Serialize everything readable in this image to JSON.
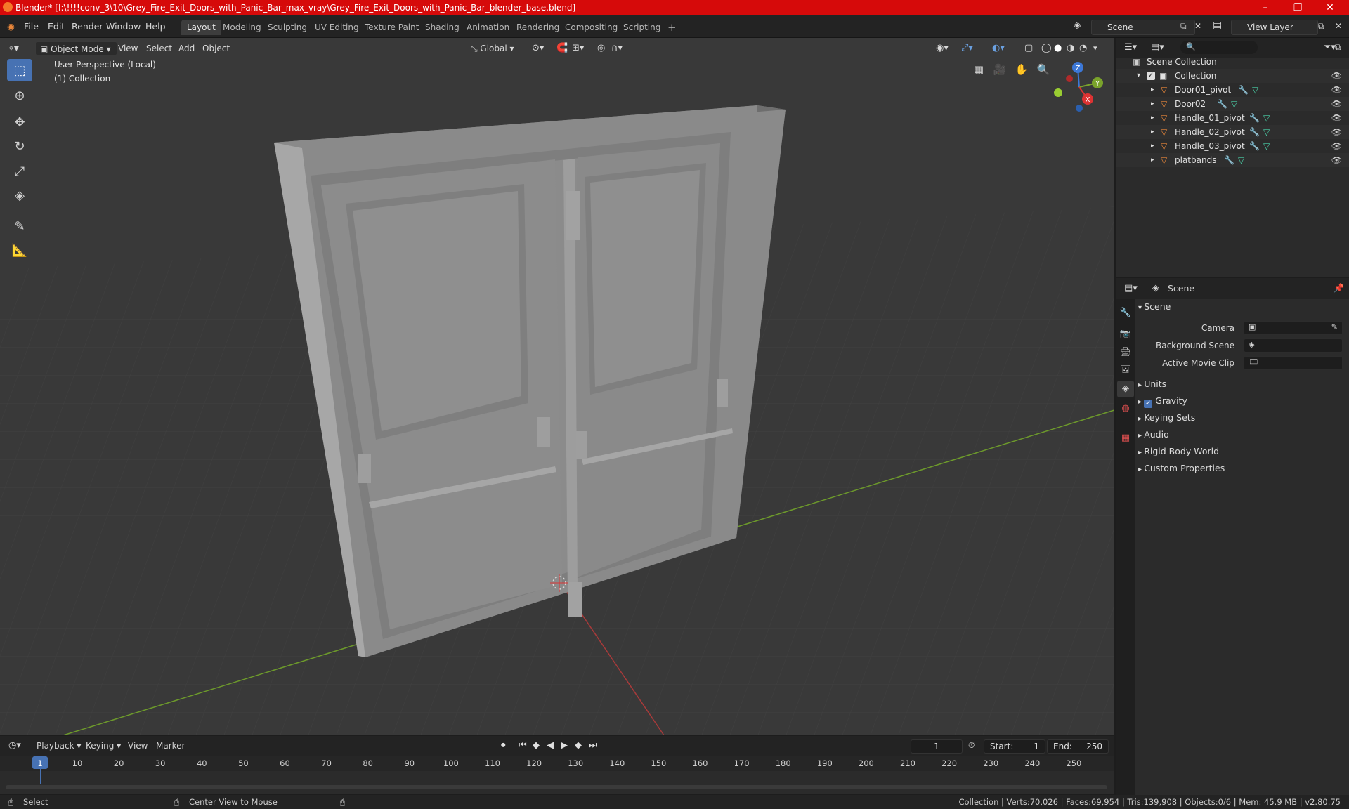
{
  "window": {
    "title": "Blender* [I:\\!!!!conv_3\\10\\Grey_Fire_Exit_Doors_with_Panic_Bar_max_vray\\Grey_Fire_Exit_Doors_with_Panic_Bar_blender_base.blend]"
  },
  "menu": [
    "File",
    "Edit",
    "Render",
    "Window",
    "Help"
  ],
  "workspaces": [
    {
      "label": "Layout",
      "active": true
    },
    {
      "label": "Modeling"
    },
    {
      "label": "Sculpting"
    },
    {
      "label": "UV Editing"
    },
    {
      "label": "Texture Paint"
    },
    {
      "label": "Shading"
    },
    {
      "label": "Animation"
    },
    {
      "label": "Rendering"
    },
    {
      "label": "Compositing"
    },
    {
      "label": "Scripting"
    }
  ],
  "scene_field": "Scene",
  "view_layer_field": "View Layer",
  "viewport": {
    "mode": "Object Mode",
    "menus": [
      "View",
      "Select",
      "Add",
      "Object"
    ],
    "transform_orientation": "Global",
    "overlay_line1": "User Perspective (Local)",
    "overlay_line2": "(1) Collection",
    "gizmo": {
      "x": "X",
      "y": "Y",
      "z": "Z"
    }
  },
  "outliner": {
    "root": "Scene Collection",
    "collection": "Collection",
    "items": [
      "Door01_pivot",
      "Door02",
      "Handle_01_pivot",
      "Handle_02_pivot",
      "Handle_03_pivot",
      "platbands"
    ]
  },
  "properties": {
    "header": "Scene",
    "panel": "Scene",
    "fields": [
      {
        "label": "Camera"
      },
      {
        "label": "Background Scene"
      },
      {
        "label": "Active Movie Clip"
      }
    ],
    "subpanels": [
      "Units",
      "Gravity",
      "Keying Sets",
      "Audio",
      "Rigid Body World",
      "Custom Properties"
    ]
  },
  "timeline": {
    "menus": [
      "Playback",
      "Keying",
      "View",
      "Marker"
    ],
    "current_frame": "1",
    "start_label": "Start:",
    "start": "1",
    "end_label": "End:",
    "end": "250",
    "ticks": [
      "1",
      "10",
      "20",
      "30",
      "40",
      "50",
      "60",
      "70",
      "80",
      "90",
      "100",
      "110",
      "120",
      "130",
      "140",
      "150",
      "160",
      "170",
      "180",
      "190",
      "200",
      "210",
      "220",
      "230",
      "240",
      "250"
    ]
  },
  "statusbar": {
    "left": "Select",
    "middle": "Center View to Mouse",
    "right": "Collection | Verts:70,026 | Faces:69,954 | Tris:139,908 | Objects:0/6 | Mem: 45.9 MB | v2.80.75"
  }
}
